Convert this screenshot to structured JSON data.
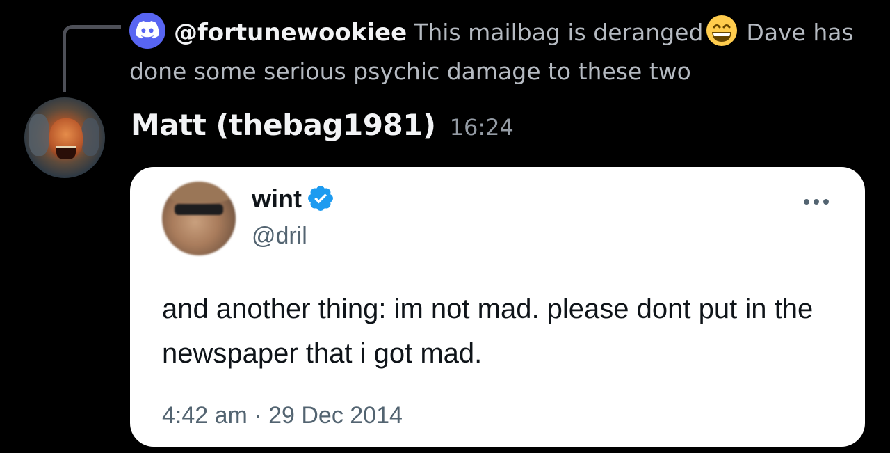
{
  "reply": {
    "author": "@fortunewookiee",
    "text_before_emoji": "This mailbag is deranged",
    "emoji": "grinning-face-with-smiling-eyes",
    "text_after_emoji": "Dave has done some serious psychic damage to these two"
  },
  "message": {
    "author": "Matt (thebag1981)",
    "timestamp": "16:24"
  },
  "tweet": {
    "display_name": "wint",
    "handle": "@dril",
    "verified": true,
    "text": "and another thing: im not mad. please dont put in the newspaper that i got mad.",
    "time": "4:42 am",
    "separator": "·",
    "date": "29 Dec 2014"
  },
  "colors": {
    "background": "#000000",
    "discord_blurple": "#5865f2",
    "verified_blue": "#1d9bf0"
  }
}
